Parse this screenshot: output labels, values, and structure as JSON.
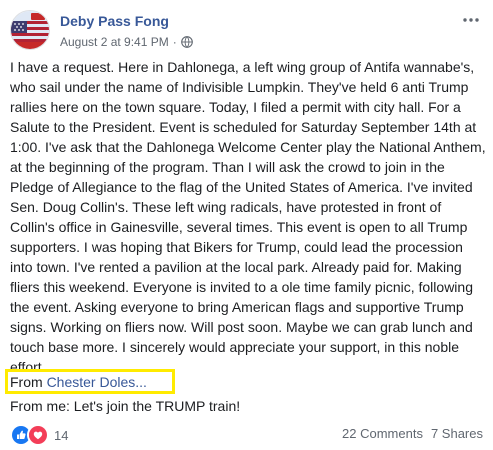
{
  "post": {
    "author": "Deby Pass Fong",
    "date": "August 2 at 9:41 PM",
    "separator": "·",
    "body": "I have a request. Here in Dahlonega, a left wing group of Antifa wannabe's, who sail under the name of Indivisible Lumpkin. They've held 6 anti Trump rallies here on the town square. Today, I filed a permit with city hall. For a Salute to the President. Event is scheduled for Saturday September 14th at 1:00. I've ask that the Dahlonega Welcome Center play the National Anthem, at the beginning of the program. Than I will ask the crowd to join in the Pledge of Allegiance to the flag of the United States of America. I've invited Sen. Doug Collin's. These left wing radicals, have protested in front of Collin's office in Gainesville, several times. This event is open to all Trump supporters. I was hoping that Bikers for Trump, could lead the procession into town. I've rented a pavilion at the local park. Already paid for. Making fliers this weekend. Everyone is invited to a ole time family picnic, following the event. Asking everyone to bring American flags and supportive Trump signs. Working on fliers now. Will post soon. Maybe we can grab lunch and touch base more. I sincerely would appreciate your support, in this noble effort.",
    "from_label": "From",
    "from_name": "Chester Doles...",
    "closing": "From me: Let's join the TRUMP train!"
  },
  "footer": {
    "reaction_count": "14",
    "comments": "22 Comments",
    "shares": "7 Shares"
  },
  "icons": {
    "privacy": "globe-icon",
    "menu": "more-horizontal-icon",
    "like": "like-reaction-icon",
    "love": "love-reaction-icon",
    "avatar": "avatar"
  },
  "colors": {
    "link": "#385898",
    "highlight_box": "#ffeb00",
    "like": "#1877f2",
    "love": "#f33e58",
    "meta_text": "#606770"
  }
}
